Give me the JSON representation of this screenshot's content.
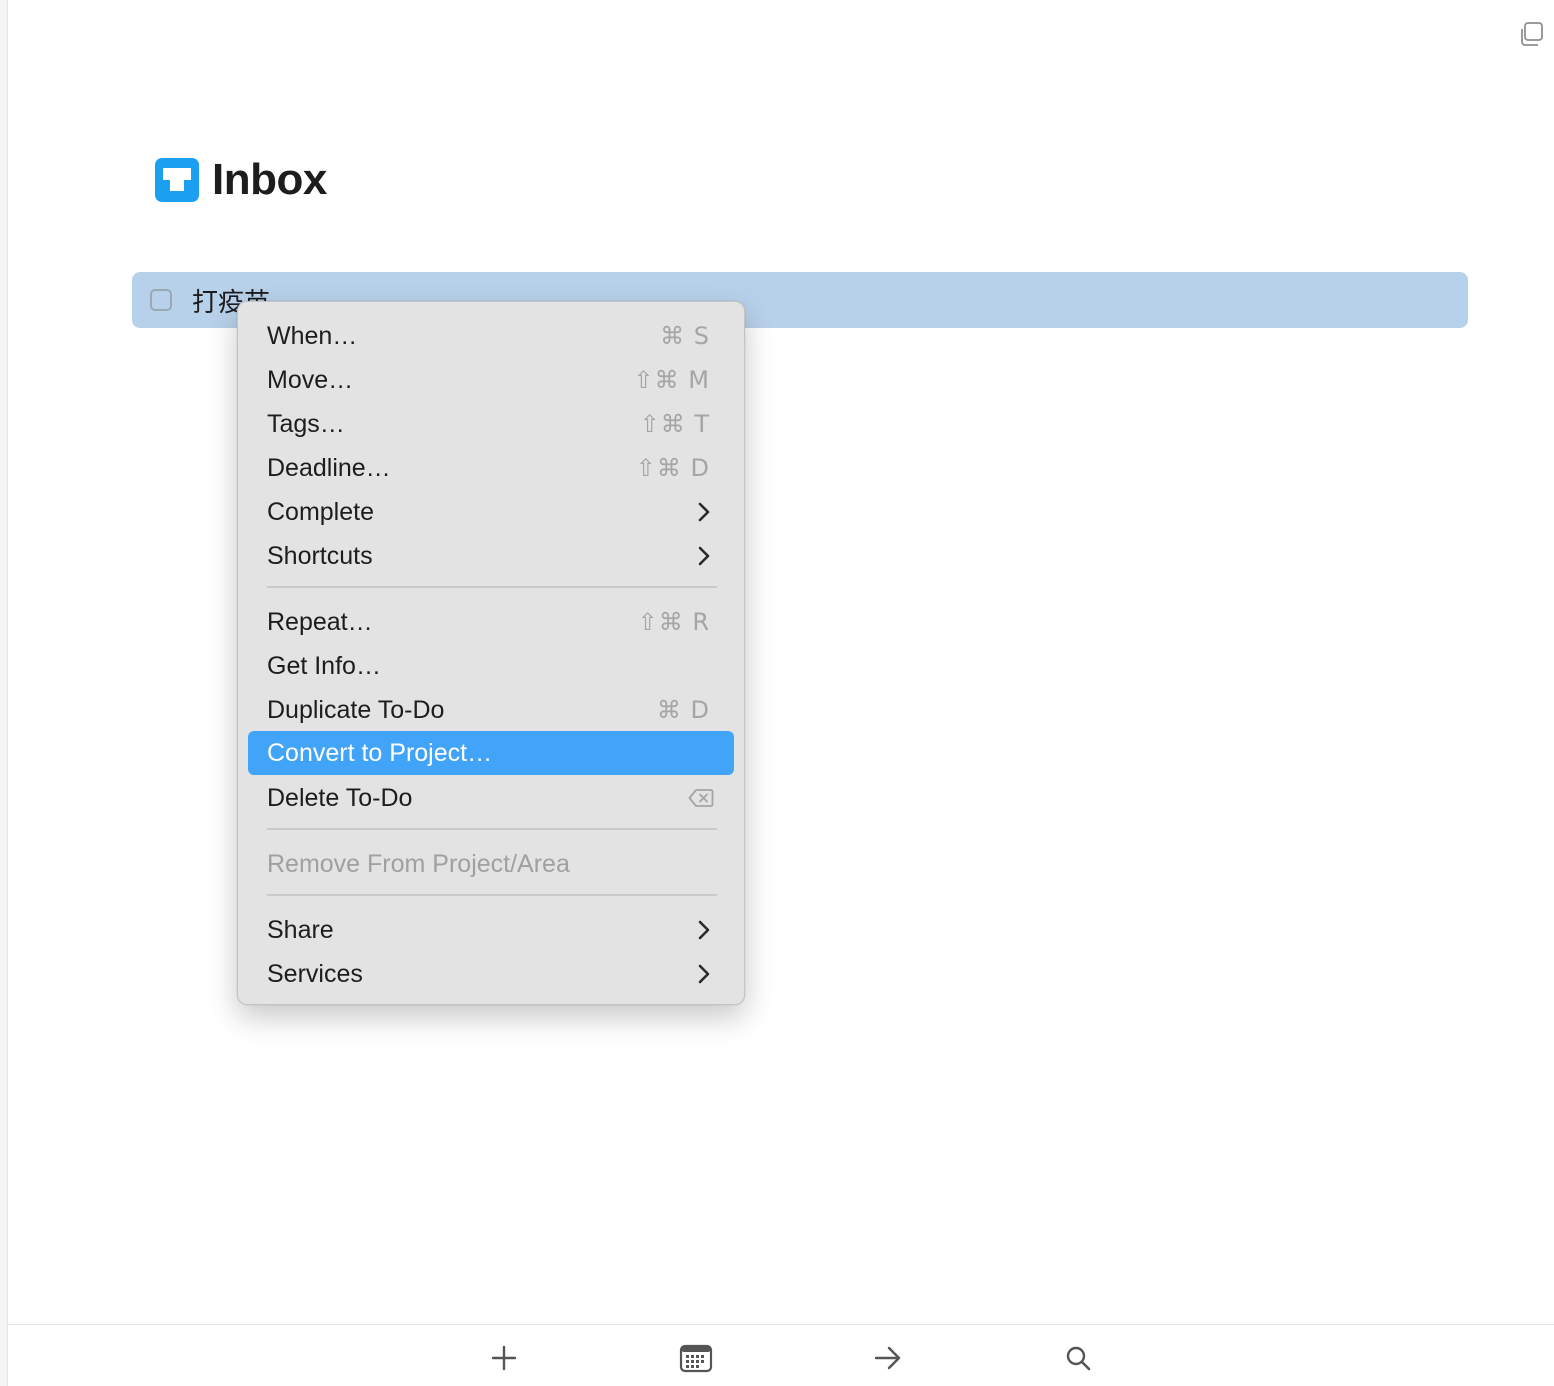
{
  "list": {
    "title": "Inbox",
    "icon": "inbox-tray-icon",
    "accent_color": "#1a9ff1"
  },
  "todos": [
    {
      "title": "打疫苗",
      "completed": false,
      "selected": true
    }
  ],
  "context_menu": {
    "highlight_color": "#42a4f9",
    "items": [
      {
        "label": "When…",
        "shortcut": "⌘ S"
      },
      {
        "label": "Move…",
        "shortcut": "⇧⌘ M"
      },
      {
        "label": "Tags…",
        "shortcut": "⇧⌘ T"
      },
      {
        "label": "Deadline…",
        "shortcut": "⇧⌘ D"
      },
      {
        "label": "Complete",
        "submenu": true
      },
      {
        "label": "Shortcuts",
        "submenu": true
      },
      {
        "label": "Repeat…",
        "shortcut": "⇧⌘ R"
      },
      {
        "label": "Get Info…"
      },
      {
        "label": "Duplicate To-Do",
        "shortcut": "⌘ D"
      },
      {
        "label": "Convert to Project…",
        "highlighted": true
      },
      {
        "label": "Delete To-Do",
        "shortcut_icon": "delete-key-icon"
      },
      {
        "label": "Remove From Project/Area",
        "disabled": true
      },
      {
        "label": "Share",
        "submenu": true
      },
      {
        "label": "Services",
        "submenu": true
      }
    ]
  },
  "toolbar": {
    "buttons": [
      "add-todo",
      "when-calendar",
      "move",
      "search"
    ]
  }
}
